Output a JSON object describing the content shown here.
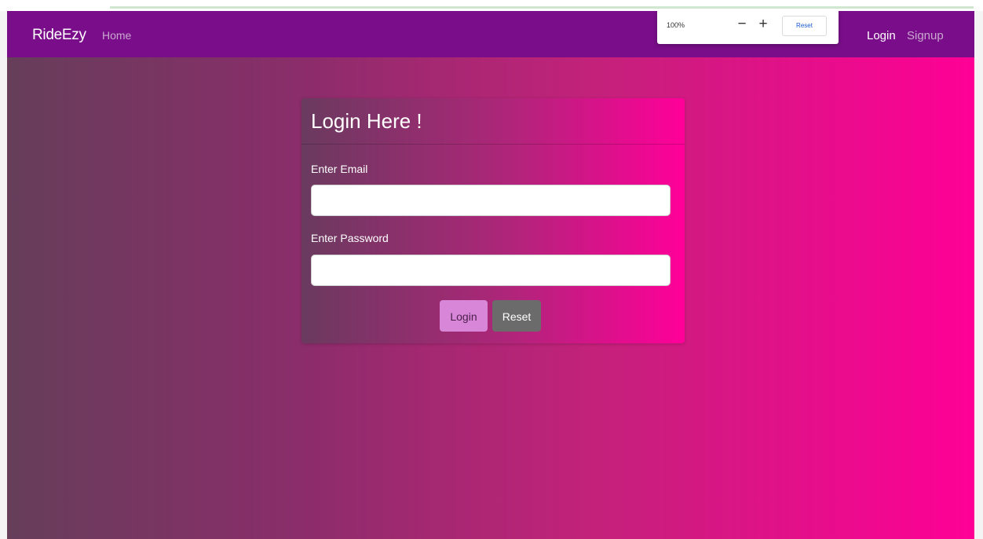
{
  "navbar": {
    "brand": "RideEzy",
    "home_label": "Home",
    "login_label": "Login",
    "signup_label": "Signup"
  },
  "zoom": {
    "level": "100%",
    "minus": "−",
    "plus": "+",
    "reset_label": "Reset"
  },
  "login_card": {
    "title": "Login Here !",
    "email_label": "Enter Email",
    "email_value": "",
    "password_label": "Enter Password",
    "password_value": "",
    "login_button": "Login",
    "reset_button": "Reset"
  },
  "colors": {
    "navbar": "#7a0e8a",
    "gradient_start": "#663e5a",
    "gradient_end": "#ff0096",
    "login_button": "#d887d8",
    "reset_button": "#6b6b6b"
  }
}
